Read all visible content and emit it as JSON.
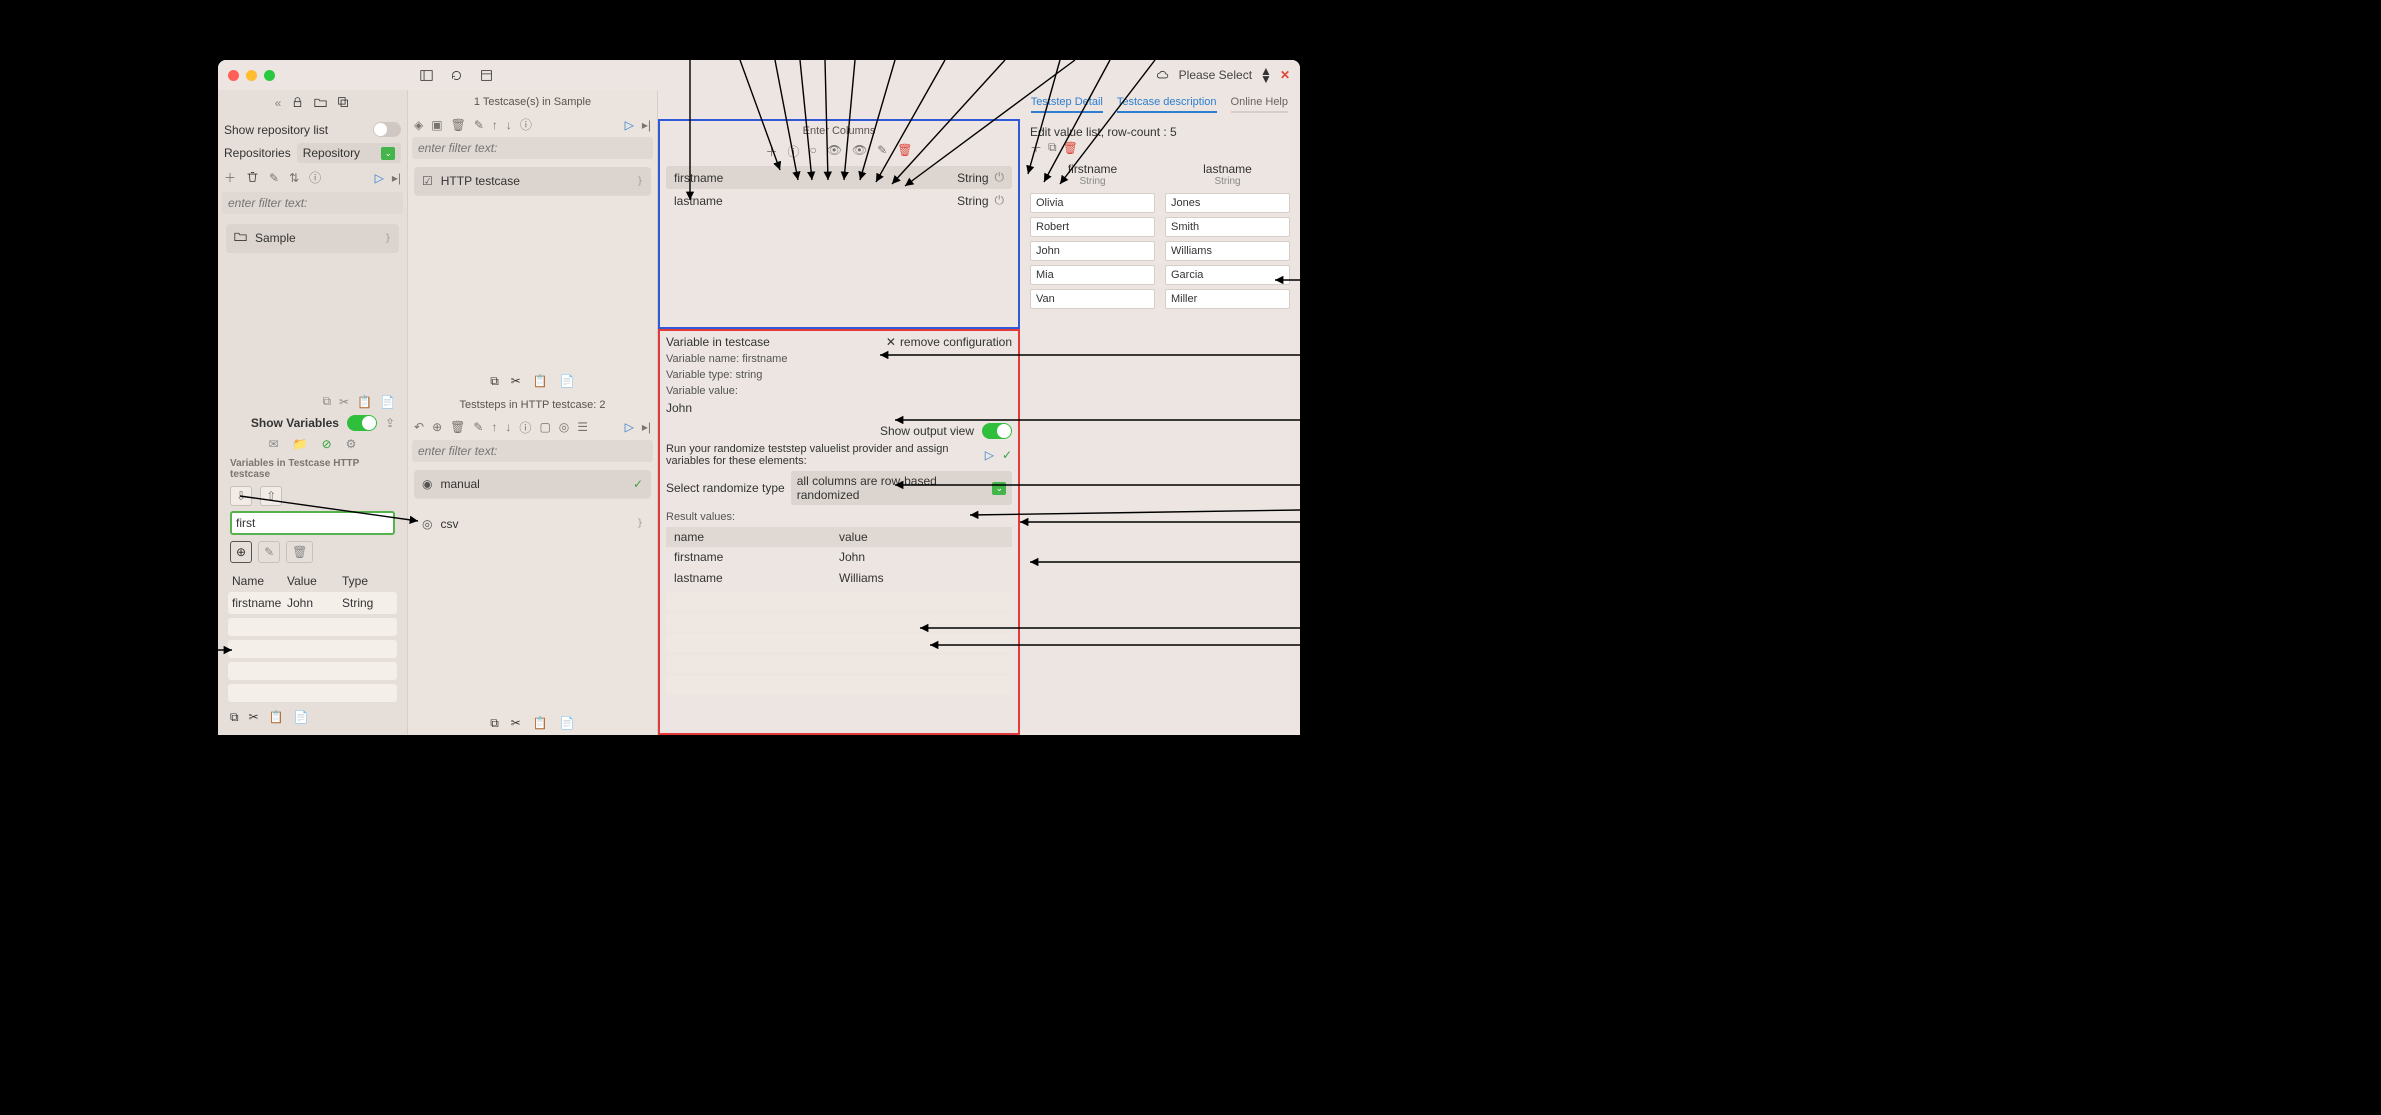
{
  "titlebar": {
    "dropdown": "Please Select"
  },
  "sidebar": {
    "show_repo_label": "Show repository list",
    "repo_label": "Repositories",
    "repo_value": "Repository",
    "filter_placeholder": "enter filter text:",
    "sample_label": "Sample",
    "sample_hint": "}",
    "sv_iconrow": {},
    "show_vars_label": "Show Variables",
    "vars_title": "Variables in Testcase HTTP testcase",
    "filter_input_value": "first",
    "table": {
      "headers": [
        "Name",
        "Value",
        "Type"
      ],
      "rows": [
        [
          "firstname",
          "John",
          "String"
        ]
      ]
    }
  },
  "midcol": {
    "top_title": "1 Testcase(s) in Sample",
    "filter_placeholder": "enter filter text:",
    "item1": "HTTP testcase",
    "item1_hint": "}",
    "ts_title": "Teststeps in HTTP testcase: 2",
    "ts_filter_placeholder": "enter filter text:",
    "ts_item1": "manual",
    "ts_item2": "csv",
    "ts_item2_hint": "}"
  },
  "tabs": {
    "t1": "Teststep Detail",
    "t2": "Testcase description",
    "t3": "Online Help"
  },
  "blockA": {
    "title": "Enter Columns",
    "rows": [
      {
        "name": "firstname",
        "type": "String"
      },
      {
        "name": "lastname",
        "type": "String"
      }
    ]
  },
  "blockB": {
    "varin": "Variable in  testcase",
    "remove": "remove configuration",
    "vn_label": "Variable name: firstname",
    "vt_label": "Variable type: string",
    "vv_label": "Variable value:",
    "vv_value": "John",
    "show_output": "Show output view",
    "run_text": "Run your randomize teststep valuelist provider and assign variables for these elements:",
    "sel_label": "Select randomize type",
    "sel_value": "all columns are row-based randomized",
    "rv_label": "Result values:",
    "rv_headers": [
      "name",
      "value"
    ],
    "rv_rows": [
      [
        "firstname",
        "John"
      ],
      [
        "lastname",
        "Williams"
      ]
    ]
  },
  "rightpane": {
    "title": "Edit value list, row-count : 5",
    "cols": [
      {
        "name": "firstname",
        "type": "String",
        "vals": [
          "Olivia",
          "Robert",
          "John",
          "Mia",
          "Van"
        ]
      },
      {
        "name": "lastname",
        "type": "String",
        "vals": [
          "Jones",
          "Smith",
          "Williams",
          "Garcia",
          "Miller"
        ]
      }
    ]
  }
}
